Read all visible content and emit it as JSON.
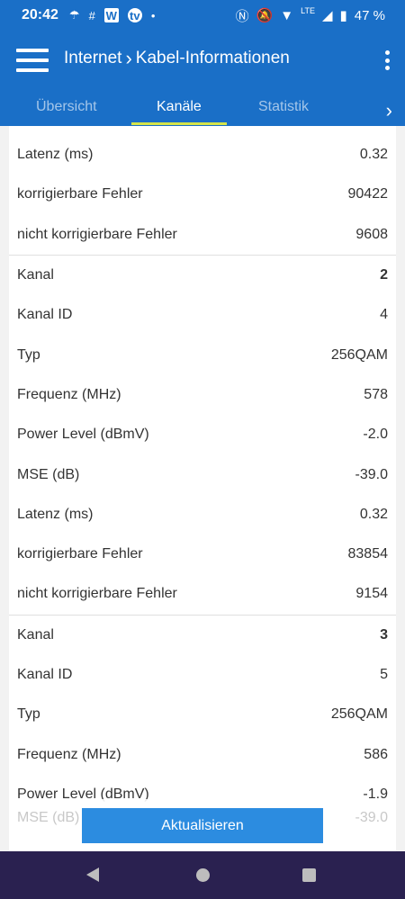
{
  "status_bar": {
    "time": "20:42",
    "battery": "47 %",
    "network": "LTE",
    "left_icons": [
      "cloud-rain-icon",
      "hash-icon",
      "w-app-icon",
      "tv-app-icon",
      "dot-icon"
    ],
    "right_icons": [
      "nfc-icon",
      "silent-icon",
      "wifi-icon",
      "signal-icon",
      "battery-icon"
    ]
  },
  "header": {
    "title_part1": "Internet",
    "title_part2": "Kabel-Informationen"
  },
  "tabs": [
    {
      "label": "Übersicht",
      "active": false
    },
    {
      "label": "Kanäle",
      "active": true
    },
    {
      "label": "Statistik",
      "active": false
    }
  ],
  "sections": [
    {
      "rows": [
        {
          "label": "Latenz (ms)",
          "value": "0.32"
        },
        {
          "label": "korrigierbare Fehler",
          "value": "90422"
        },
        {
          "label": "nicht korrigierbare Fehler",
          "value": "9608"
        }
      ]
    },
    {
      "rows": [
        {
          "label": "Kanal",
          "value": "2",
          "bold": true
        },
        {
          "label": "Kanal ID",
          "value": "4"
        },
        {
          "label": "Typ",
          "value": "256QAM"
        },
        {
          "label": "Frequenz (MHz)",
          "value": "578"
        },
        {
          "label": "Power Level (dBmV)",
          "value": "-2.0"
        },
        {
          "label": "MSE (dB)",
          "value": "-39.0"
        },
        {
          "label": "Latenz (ms)",
          "value": "0.32"
        },
        {
          "label": "korrigierbare Fehler",
          "value": "83854"
        },
        {
          "label": "nicht korrigierbare Fehler",
          "value": "9154"
        }
      ]
    },
    {
      "rows": [
        {
          "label": "Kanal",
          "value": "3",
          "bold": true
        },
        {
          "label": "Kanal ID",
          "value": "5"
        },
        {
          "label": "Typ",
          "value": "256QAM"
        },
        {
          "label": "Frequenz (MHz)",
          "value": "586"
        },
        {
          "label": "Power Level (dBmV)",
          "value": "-1.9"
        }
      ]
    }
  ],
  "faded_row": {
    "label": "MSE (dB)",
    "value": "-39.0"
  },
  "update_button": "Aktualisieren",
  "colors": {
    "primary": "#1a6fc7",
    "tab_indicator": "#d4e34a",
    "button": "#2c8ce0",
    "navbar": "#2a2150"
  }
}
